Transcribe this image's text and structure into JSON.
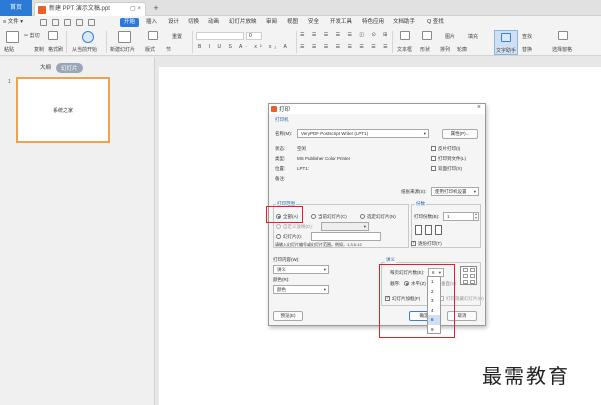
{
  "titlebar": {
    "home": "首页",
    "doc_tab": "新建 PPT 演示文稿.ppt",
    "tab_controls": "▢ ×",
    "new_tab": "+"
  },
  "menubar": {
    "file": "≡ 文件 ▾",
    "start": "开始",
    "items": [
      "插入",
      "设计",
      "切换",
      "动画",
      "幻灯片放映",
      "审阅",
      "视图",
      "安全",
      "开发工具",
      "特色应用",
      "文档助手"
    ],
    "search": "Q 查找"
  },
  "ribbon": {
    "paste": "粘贴",
    "cut": "✂ 剪切",
    "copy": "复制",
    "format_painter": "格式刷",
    "from_current": "从当前开始",
    "new_slide": "新建幻灯片",
    "layout": "版式",
    "section": "节",
    "reset": "重置",
    "font_size": "0",
    "text_box": "文本框",
    "shape": "形状",
    "arrange": "排列",
    "outline": "轮廓",
    "picture": "图片",
    "fill": "填充",
    "find": "查找",
    "text_assistant": "文字助手",
    "replace": "替换",
    "select_pane": "选择窗格"
  },
  "leftpanel": {
    "outline_tab": "大纲",
    "slides_tab": "幻灯片",
    "slide_num": "1",
    "slide_text": "系统之家"
  },
  "dialog": {
    "title": "打印",
    "printer_group": "打印机",
    "name_label": "名称(M):",
    "printer_name": "VeryPDF Postscript Writer (LPT1)",
    "properties": "属性(P)...",
    "status_label": "状态:",
    "status_value": "空闲",
    "type_label": "类型:",
    "type_value": "MS Publisher Color Printer",
    "location_label": "位置:",
    "location_value": "LPT1:",
    "comment_label": "备注:",
    "reverse": "反片打印(I)",
    "print_to_file": "打印到文件(L)",
    "duplex": "双面打印(X)",
    "paper_source_label": "纸张来源(S):",
    "paper_source": "使用打印机设置",
    "range_group": "打印范围",
    "all": "全部(A)",
    "current_slide": "当前幻灯片(C)",
    "selection": "选定幻灯片(N)",
    "custom_show": "自定义放映(D):",
    "slides": "幻灯片(I):",
    "hint": "请输入幻灯片编号或幻灯片范围。例如，1,3,5-12",
    "copies_group": "份数",
    "copies_label": "打印份数(B):",
    "copies": "1",
    "collate": "逐份打印(T)",
    "print_content_label": "打印内容(W):",
    "print_content": "讲义",
    "color_label": "颜色(R):",
    "color": "颜色",
    "handout_group": "讲义",
    "per_page_label": "每页幻灯片数(E):",
    "per_page": "6",
    "order_label": "顺序:",
    "horizontal": "水平(Z)",
    "vertical": "垂直(V)",
    "frame_slides": "幻灯片加框(F)",
    "print_hidden": "打印隐藏幻灯片(H)",
    "preview": "预览(E)",
    "ok": "确定",
    "cancel": "取消"
  },
  "droplist": [
    "1",
    "2",
    "3",
    "4",
    "6",
    "9"
  ],
  "watermark": "最需教育"
}
